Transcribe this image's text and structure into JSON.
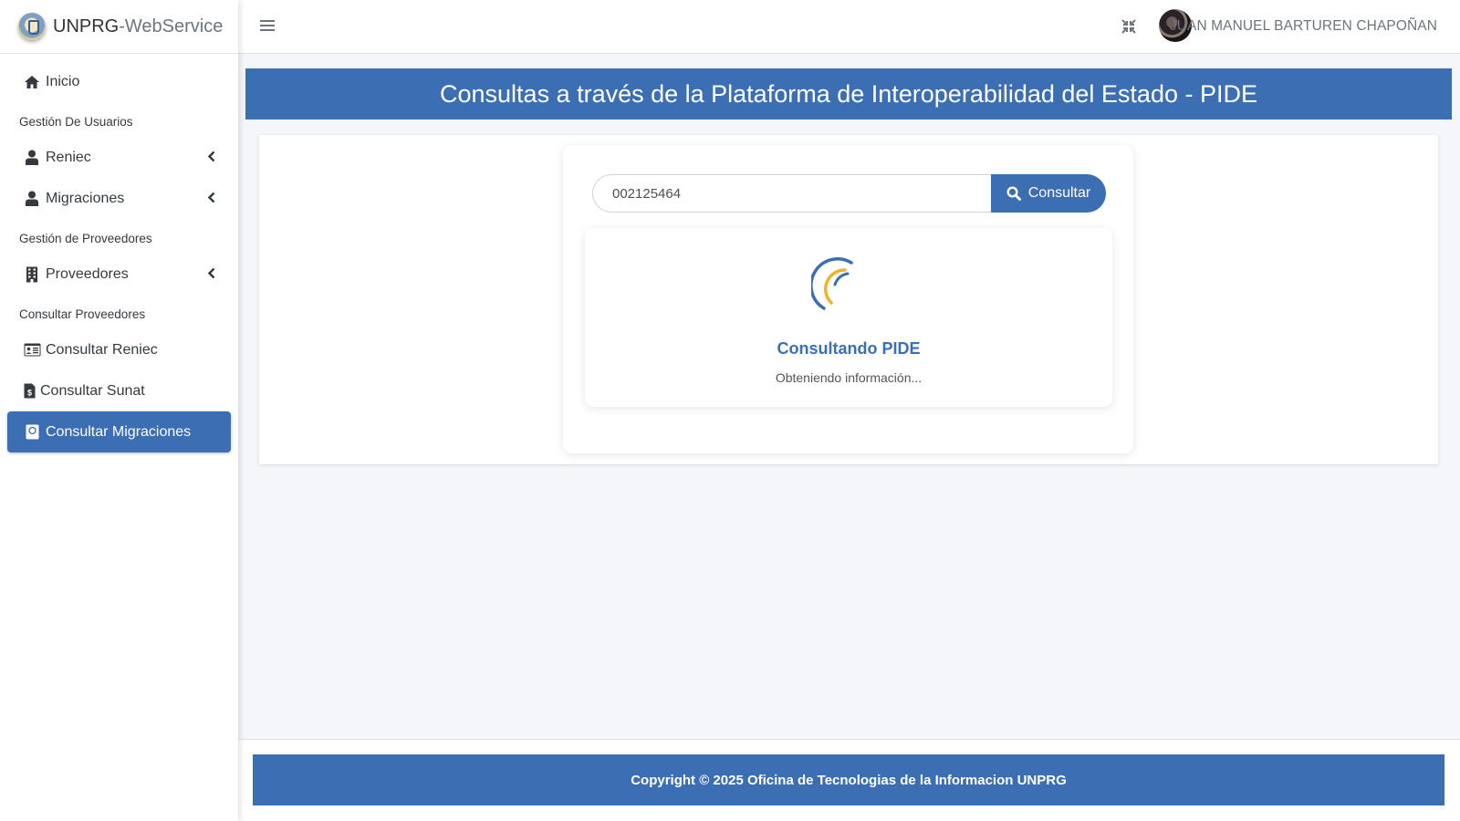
{
  "brand": {
    "name_bold": "UNPRG",
    "name_light": "-WebService"
  },
  "topbar": {
    "user_name": "JUAN MANUEL BARTUREN CHAPOÑAN"
  },
  "sidebar": {
    "home": "Inicio",
    "section_users": "Gestión De Usuarios",
    "reniec": "Reniec",
    "migraciones": "Migraciones",
    "section_providers": "Gestión de Proveedores",
    "proveedores": "Proveedores",
    "section_consult": "Consultar Proveedores",
    "consultar_reniec": "Consultar Reniec",
    "consultar_sunat": "Consultar Sunat",
    "consultar_migraciones": "Consultar Migraciones"
  },
  "page": {
    "title": "Consultas a través de la Plataforma de Interoperabilidad del Estado - PIDE",
    "search_value": "002125464",
    "search_button": "Consultar",
    "loading_title": "Consultando PIDE",
    "loading_subtitle": "Obteniendo información..."
  },
  "footer": {
    "text": "Copyright © 2025 Oficina de Tecnologias de la Informacion UNPRG"
  },
  "colors": {
    "primary": "#3c6eb4",
    "spinner_accent": "#f0b429",
    "background": "#f4f6f9"
  }
}
